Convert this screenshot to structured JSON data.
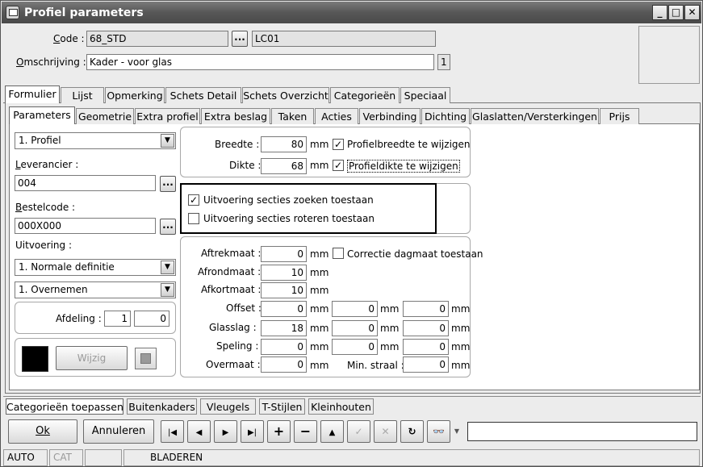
{
  "window": {
    "title": "Profiel parameters"
  },
  "header": {
    "code_label": "Code :",
    "code_value": "68_STD",
    "code_extra": "LC01",
    "omschrijving_label": "Omschrijving :",
    "omschrijving_value": "Kader - voor glas",
    "omschrijving_count": "1",
    "dots_label": "..."
  },
  "main_tabs": [
    {
      "label": "Formulier"
    },
    {
      "label": "Lijst"
    },
    {
      "label": "Opmerking"
    },
    {
      "label": "Schets Detail"
    },
    {
      "label": "Schets Overzicht"
    },
    {
      "label": "Categorieën"
    },
    {
      "label": "Speciaal"
    }
  ],
  "sub_tabs": [
    {
      "label": "Parameters"
    },
    {
      "label": "Geometrie"
    },
    {
      "label": "Extra profiel"
    },
    {
      "label": "Extra beslag"
    },
    {
      "label": "Taken"
    },
    {
      "label": "Acties"
    },
    {
      "label": "Verbinding"
    },
    {
      "label": "Dichting"
    },
    {
      "label": "Glaslatten/Versterkingen"
    },
    {
      "label": "Prijs"
    }
  ],
  "left": {
    "type_select": "1.  Profiel",
    "leverancier_label": "Leverancier :",
    "leverancier_value": "004",
    "bestelcode_label": "Bestelcode :",
    "bestelcode_value": "000X000",
    "uitvoering_label": "Uitvoering :",
    "uitvoering_select": "1.  Normale definitie",
    "overnemen_select": "1.  Overnemen",
    "afdeling_label": "Afdeling :",
    "afdeling_1": "1",
    "afdeling_2": "0",
    "wijzig_label": "Wijzig",
    "swatch_color": "#000000"
  },
  "dimensions": {
    "breedte_label": "Breedte :",
    "breedte_value": "80",
    "dikte_label": "Dikte :",
    "dikte_value": "68",
    "unit": "mm",
    "breedte_check_label": "Profielbreedte te wijzigen",
    "dikte_check_label": "Profieldikte te wijzigen"
  },
  "secties": {
    "zoeken_label": "Uitvoering secties zoeken toestaan",
    "roteren_label": "Uitvoering secties roteren toestaan"
  },
  "maten": {
    "aftrekmaat_label": "Aftrekmaat :",
    "aftrekmaat_value": "0",
    "correctie_label": "Correctie dagmaat toestaan",
    "afrondmaat_label": "Afrondmaat :",
    "afrondmaat_value": "10",
    "afkortmaat_label": "Afkortmaat :",
    "afkortmaat_value": "10",
    "offset_label": "Offset :",
    "offset_values": [
      "0",
      "0",
      "0"
    ],
    "glasslag_label": "Glasslag :",
    "glasslag_values": [
      "18",
      "0",
      "0"
    ],
    "speling_label": "Speling :",
    "speling_values": [
      "0",
      "0",
      "0"
    ],
    "overmaat_label": "Overmaat :",
    "overmaat_value": "0",
    "min_straal_label": "Min. straal :",
    "min_straal_value": "0"
  },
  "bottom_tabs": [
    {
      "label": "Categorieën toepassen"
    },
    {
      "label": "Buitenkaders"
    },
    {
      "label": "Vleugels"
    },
    {
      "label": "T-Stijlen"
    },
    {
      "label": "Kleinhouten"
    }
  ],
  "toolbar": {
    "ok_label": "Ok",
    "annuleren_label": "Annuleren"
  },
  "status": {
    "mode": "AUTO",
    "cat": "CAT",
    "state": "BLADEREN"
  }
}
